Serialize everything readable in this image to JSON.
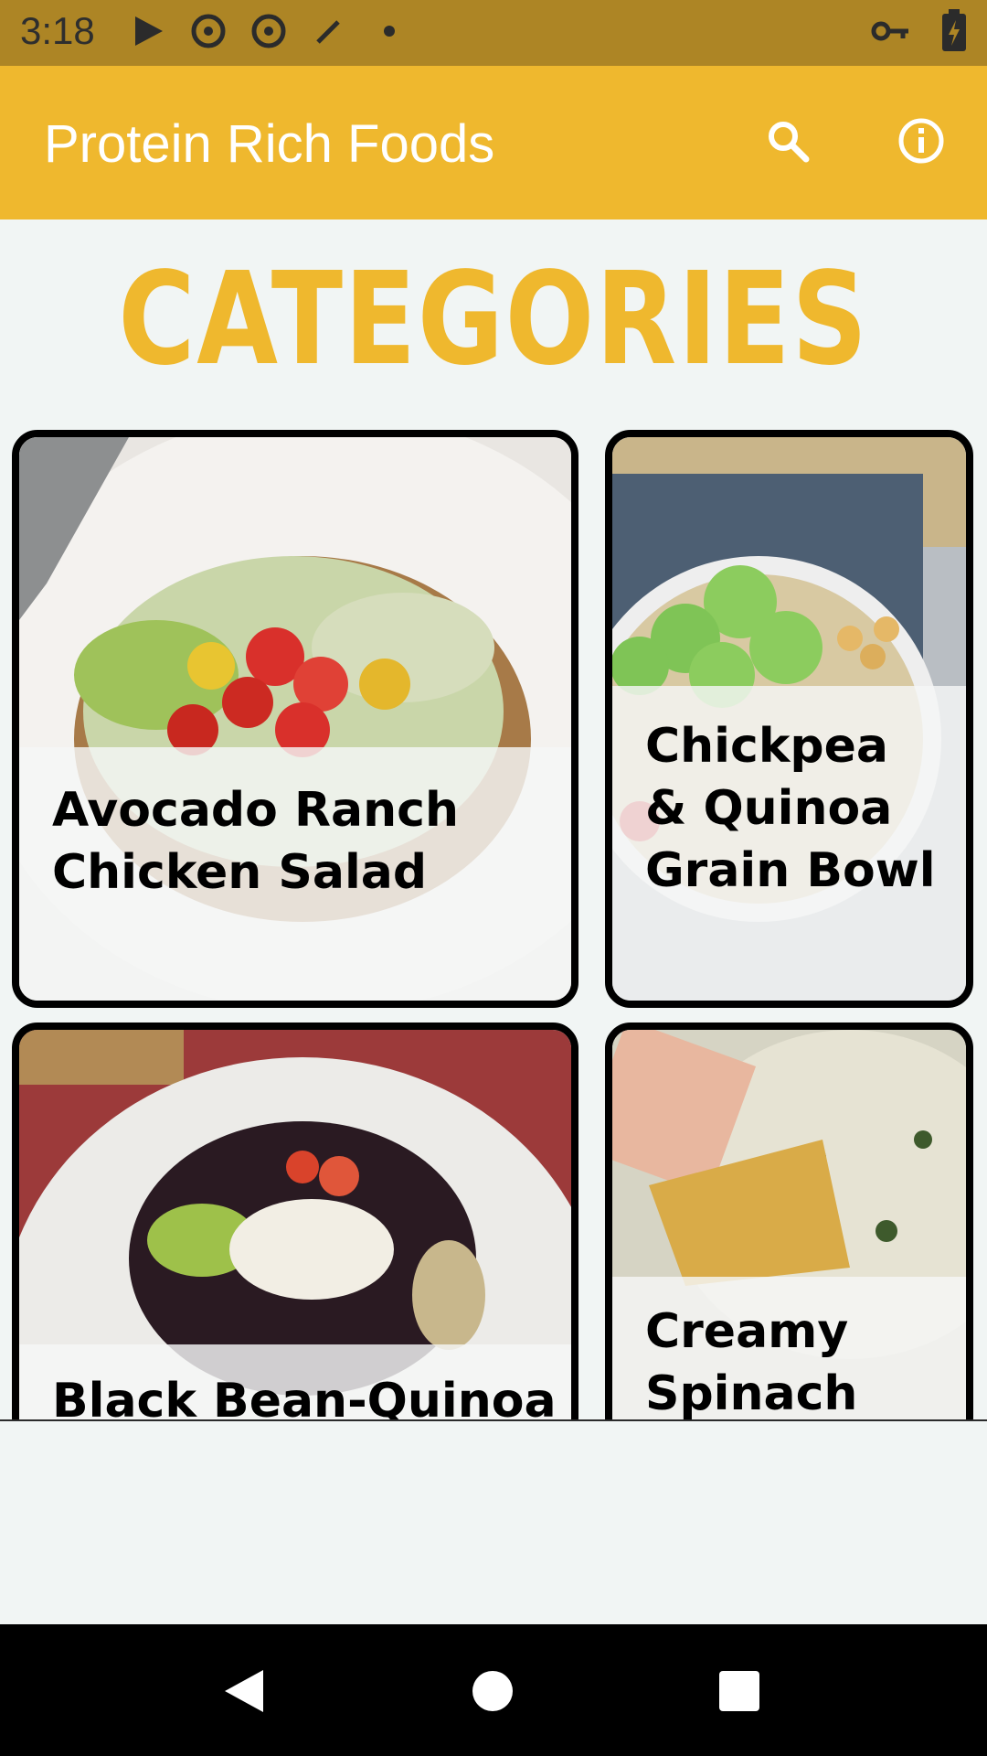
{
  "status_bar": {
    "time": "3:18",
    "left_icons": [
      "play-store-icon",
      "sync-icon",
      "sync-icon",
      "wand-icon",
      "dot-icon"
    ],
    "right_icons": [
      "vpn-key-icon",
      "battery-charging-icon"
    ]
  },
  "app_bar": {
    "title": "Protein Rich Foods",
    "actions": [
      "search-icon",
      "info-icon"
    ],
    "color": "#efb82e"
  },
  "heading": "CATEGORIES",
  "cards": [
    {
      "label": "Avocado Ranch Chicken Salad",
      "lines": [
        "Avocado Ranch",
        "Chicken Salad"
      ]
    },
    {
      "label": "Chickpea & Quinoa Grain Bowl",
      "lines": [
        "Chickpea",
        "& Quinoa",
        "Grain Bowl"
      ]
    },
    {
      "label": "Black Bean-Quinoa",
      "lines": [
        "Black Bean-Quinoa"
      ]
    },
    {
      "label": "Creamy Spinach",
      "lines": [
        "Creamy",
        "Spinach"
      ]
    }
  ],
  "nav_bar": {
    "buttons": [
      "back-icon",
      "home-icon",
      "recents-icon"
    ]
  }
}
